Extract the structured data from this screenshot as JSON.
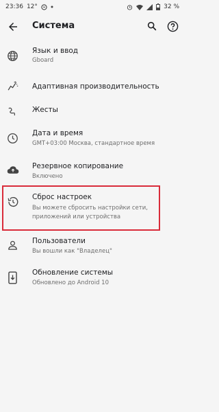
{
  "status_bar": {
    "time": "23:36",
    "temp": "12°",
    "battery": "32 %"
  },
  "toolbar": {
    "title": "Система"
  },
  "items": [
    {
      "title": "Язык и ввод",
      "subtitle": "Gboard",
      "icon": "globe-icon"
    },
    {
      "title": "Адаптивная производительность",
      "subtitle": "",
      "icon": "adaptive-performance-icon"
    },
    {
      "title": "Жесты",
      "subtitle": "",
      "icon": "gestures-icon"
    },
    {
      "title": "Дата и время",
      "subtitle": "GMT+03:00 Москва, стандартное время",
      "icon": "clock-icon"
    },
    {
      "title": "Резервное копирование",
      "subtitle": "Включено",
      "icon": "cloud-upload-icon"
    },
    {
      "title": "Сброс настроек",
      "subtitle_line1": "Вы можете сбросить настройки сети,",
      "subtitle_line2": "приложений или устройства",
      "icon": "history-icon"
    },
    {
      "title": "Пользователи",
      "subtitle": "Вы вошли как \"Владелец\"",
      "icon": "person-icon"
    },
    {
      "title": "Обновление системы",
      "subtitle": "Обновлено до Android 10",
      "icon": "system-update-icon"
    }
  ],
  "colors": {
    "highlight": "#d92b3a",
    "background": "#f5f5f5"
  }
}
